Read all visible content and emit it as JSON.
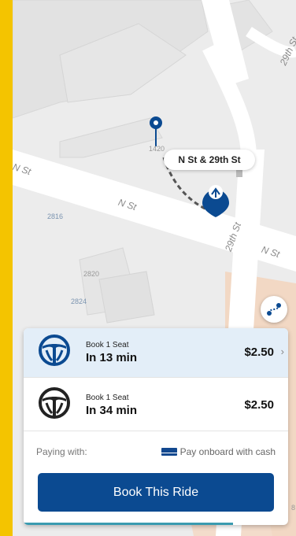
{
  "map": {
    "streets": {
      "n_st_left": "N St",
      "n_st_mid": "N St",
      "n_st_right": "N St",
      "st_29th": "29th St",
      "st_29th_top": "29th St"
    },
    "numbers": {
      "n1420": "1420",
      "n2816": "2816",
      "n2820": "2820",
      "n2824": "2824",
      "n8": "8"
    },
    "callout": "N St & 29th St"
  },
  "rides": [
    {
      "line1": "Book 1 Seat",
      "line2": "In 13 min",
      "price": "$2.50",
      "chevron": "›",
      "selected": true
    },
    {
      "line1": "Book 1 Seat",
      "line2": "In 34 min",
      "price": "$2.50",
      "selected": false
    }
  ],
  "payment": {
    "label": "Paying with:",
    "method": "Pay onboard with cash",
    "icon": "cash-icon"
  },
  "book_button": "Book This Ride",
  "colors": {
    "brand_blue": "#0b4a91",
    "frame_yellow": "#f4c400",
    "selected_bg": "#e3eef8"
  }
}
